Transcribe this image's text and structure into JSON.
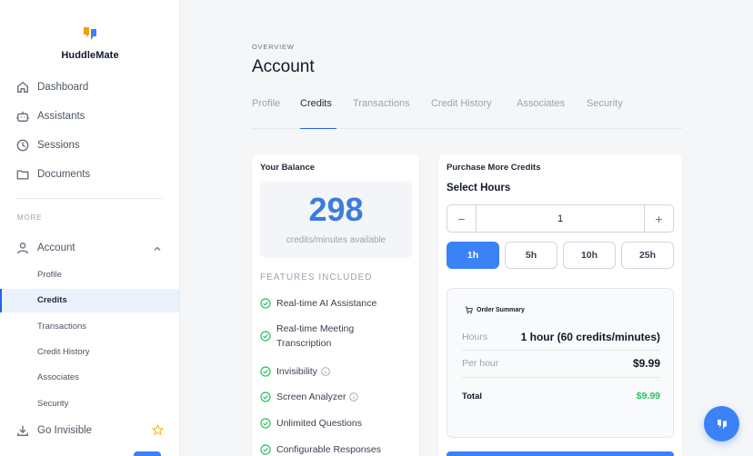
{
  "app": {
    "name": "HuddleMate"
  },
  "sidebar": {
    "primary": [
      {
        "label": "Dashboard",
        "icon": "home-icon"
      },
      {
        "label": "Assistants",
        "icon": "robot-icon"
      },
      {
        "label": "Sessions",
        "icon": "clock-icon"
      },
      {
        "label": "Documents",
        "icon": "folder-icon"
      }
    ],
    "more_label": "MORE",
    "account": {
      "label": "Account",
      "icon": "user-icon",
      "expanded": true
    },
    "sub_items": [
      "Profile",
      "Credits",
      "Transactions",
      "Credit History",
      "Associates",
      "Security"
    ],
    "active_sub": "Credits",
    "go_invisible": {
      "label": "Go Invisible",
      "icon": "download-icon"
    }
  },
  "header": {
    "overline": "OVERVIEW",
    "title": "Account"
  },
  "tabs": [
    "Profile",
    "Credits",
    "Transactions",
    "Credit History",
    "Associates",
    "Security"
  ],
  "active_tab": "Credits",
  "balance": {
    "title": "Your Balance",
    "value": "298",
    "caption": "credits/minutes available",
    "features_title": "FEATURES INCLUDED",
    "features": [
      {
        "line1": "Real-time AI Assistance",
        "line2": "",
        "info": false
      },
      {
        "line1": "Real-time Meeting",
        "line2": "Transcription",
        "info": false
      },
      {
        "line1": "Invisibility",
        "line2": "",
        "info": true
      },
      {
        "line1": "Screen Analyzer",
        "line2": "",
        "info": true
      },
      {
        "line1": "Unlimited Questions",
        "line2": "",
        "info": false
      },
      {
        "line1": "Configurable Responses",
        "line2": "",
        "info": false
      }
    ]
  },
  "purchase": {
    "title": "Purchase More Credits",
    "select_label": "Select Hours",
    "minus": "−",
    "plus": "+",
    "quantity": "1",
    "presets": [
      "1h",
      "5h",
      "10h",
      "25h"
    ],
    "selected_preset": "1h",
    "summary": {
      "title": "Order Summary",
      "hours_label": "Hours",
      "hours_value": "1 hour (60 credits/minutes)",
      "per_hour_label": "Per hour",
      "per_hour_value": "$9.99",
      "total_label": "Total",
      "total_value": "$9.99"
    }
  },
  "colors": {
    "accent": "#3b82f6",
    "balance": "#3b7ddd",
    "total": "#22c55e",
    "check": "#22c55e"
  }
}
